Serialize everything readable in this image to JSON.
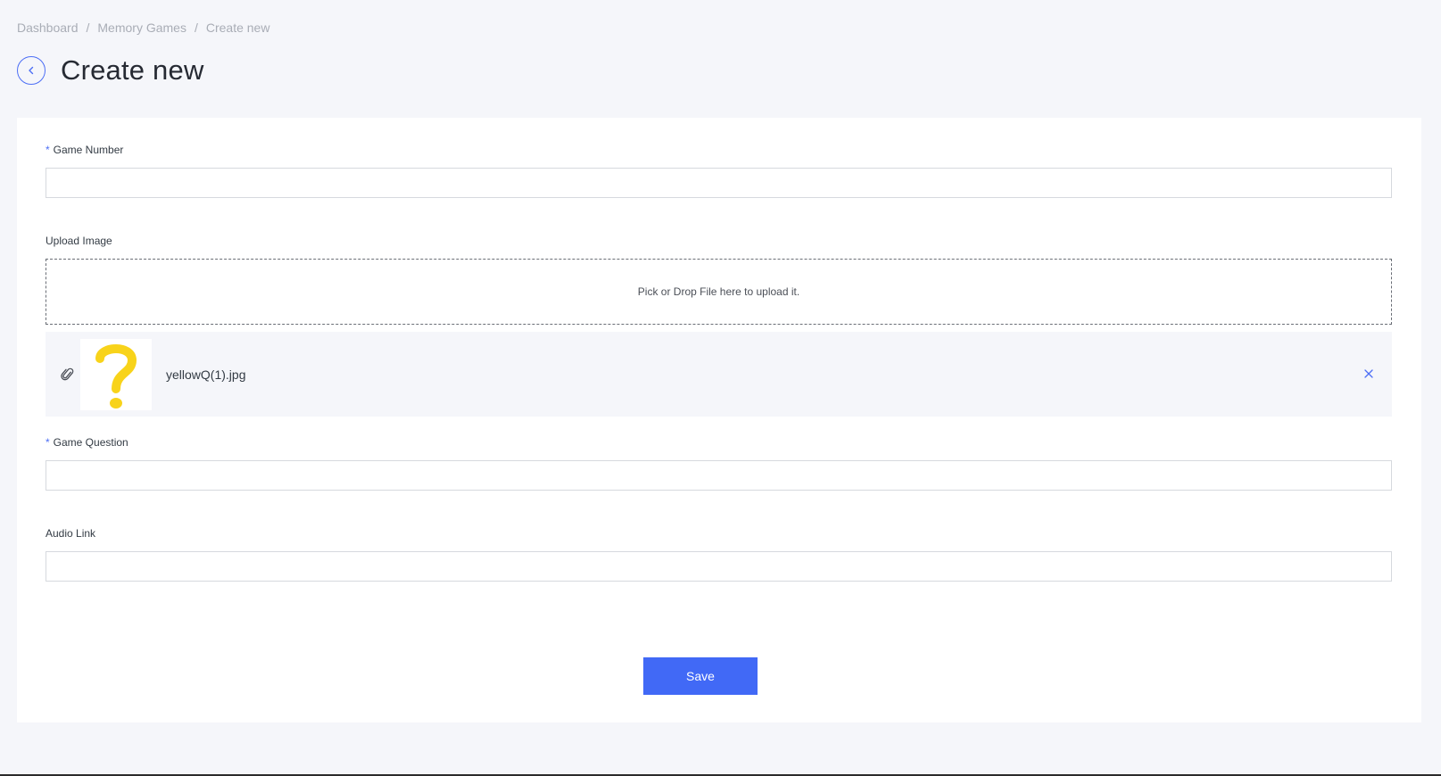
{
  "breadcrumb": {
    "items": [
      "Dashboard",
      "Memory Games",
      "Create new"
    ],
    "separator": "/"
  },
  "header": {
    "title": "Create new",
    "back_icon": "chevron-left-icon"
  },
  "form": {
    "game_number": {
      "label": "Game Number",
      "required_mark": "*",
      "value": "",
      "placeholder": ""
    },
    "upload_image": {
      "label": "Upload Image",
      "dropzone_text": "Pick or Drop File here to upload it.",
      "file": {
        "name": "yellowQ(1).jpg",
        "thumbnail_icon": "question-mark-icon",
        "thumbnail_color": "#f8d31a"
      }
    },
    "game_question": {
      "label": "Game Question",
      "required_mark": "*",
      "value": "",
      "placeholder": ""
    },
    "audio_link": {
      "label": "Audio Link",
      "value": "",
      "placeholder": ""
    },
    "save_label": "Save"
  },
  "colors": {
    "accent": "#4169f6",
    "background": "#f5f6fa",
    "card": "#ffffff"
  }
}
